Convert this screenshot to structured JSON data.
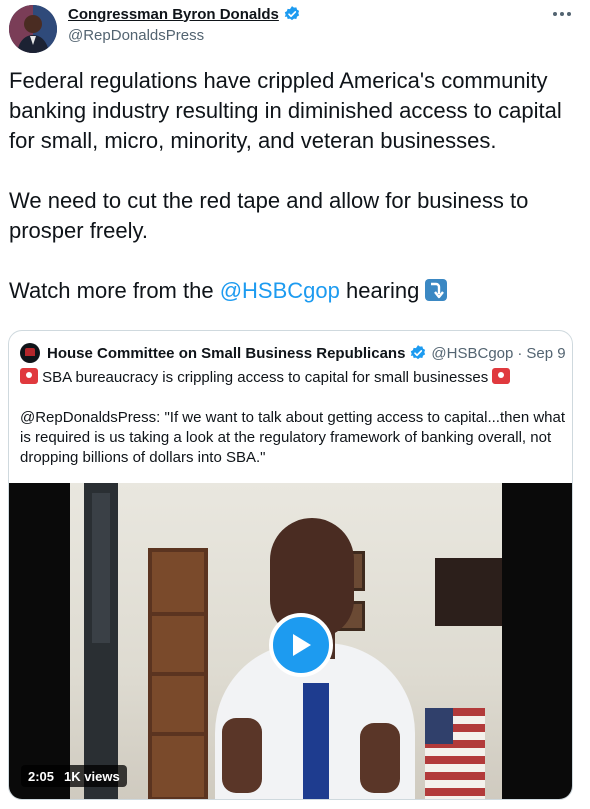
{
  "author": {
    "name": "Congressman Byron Donalds",
    "handle": "@RepDonaldsPress"
  },
  "tweet": {
    "paragraph1": "Federal regulations have crippled America's community banking industry resulting in diminished access to capital for small, micro, minority, and veteran businesses.",
    "paragraph2": "We need to cut the red tape and allow for business to prosper freely.",
    "watch_prefix": "Watch more from the ",
    "watch_mention": "@HSBCgop",
    "watch_suffix": " hearing "
  },
  "quote": {
    "name": "House Committee on Small Business Republicans",
    "handle": "@HSBCgop",
    "separator": "·",
    "date": "Sep 9",
    "headline": "SBA bureaucracy is crippling access to capital for small businesses",
    "body": "@RepDonaldsPress: \"If we want to talk about getting access to capital...then what is required is us taking a look at the regulatory framework of banking overall, not dropping billions of dollars into SBA.\""
  },
  "video": {
    "duration": "2:05",
    "views": "1K views"
  },
  "icons": {
    "verified": "verified-badge-icon",
    "more": "more-options-icon",
    "siren": "police-light-emoji-icon",
    "arrow": "right-arrow-curving-down-emoji-icon",
    "play": "play-icon"
  },
  "colors": {
    "accent": "#1d9bf0",
    "text": "#0f1419",
    "secondary": "#536471",
    "border": "#cfd9de"
  }
}
